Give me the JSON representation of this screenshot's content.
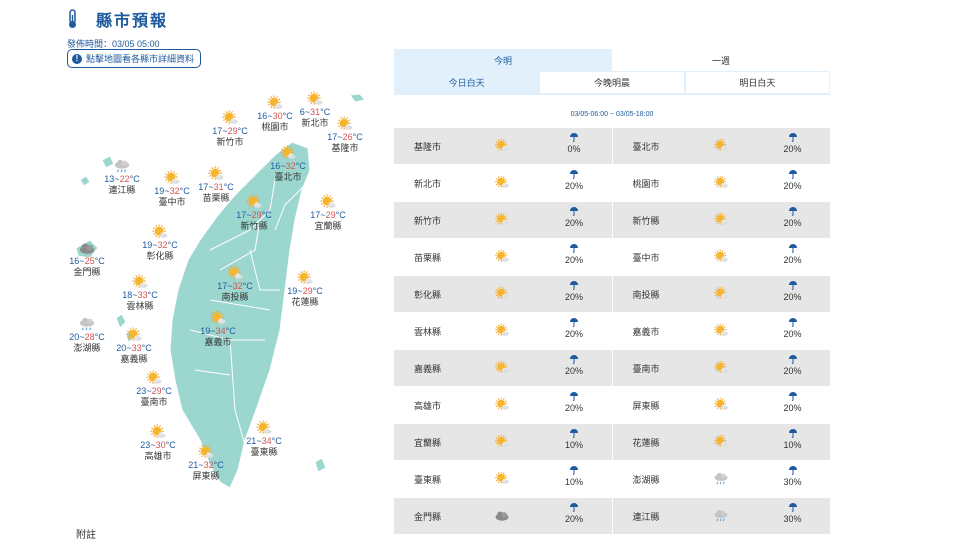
{
  "header": {
    "title": "縣市預報",
    "publish_time": "發佈時間：03/05 05:00",
    "detail_button": "點擊地圖看各縣市詳細資料"
  },
  "map_cities": [
    {
      "name": "新竹市",
      "low": "17",
      "high": "29",
      "weather": "sunny-cloudy"
    },
    {
      "name": "桃園市",
      "low": "16",
      "high": "30",
      "weather": "sunny-cloudy"
    },
    {
      "name": "新北市",
      "low": "6",
      "high": "31",
      "weather": "sunny-cloudy"
    },
    {
      "name": "基隆市",
      "low": "17",
      "high": "26",
      "weather": "sunny-cloudy"
    },
    {
      "name": "連江縣",
      "low": "13",
      "high": "22",
      "weather": "cloudy-rain"
    },
    {
      "name": "臺中市",
      "low": "19",
      "high": "32",
      "weather": "sunny-cloudy"
    },
    {
      "name": "苗栗縣",
      "low": "17",
      "high": "31",
      "weather": "sunny-cloudy"
    },
    {
      "name": "臺北市",
      "low": "16",
      "high": "32",
      "weather": "sunny-cloudy"
    },
    {
      "name": "新竹縣",
      "low": "17",
      "high": "29",
      "weather": "sunny-cloudy"
    },
    {
      "name": "宜蘭縣",
      "low": "17",
      "high": "29",
      "weather": "sunny-cloudy"
    },
    {
      "name": "彰化縣",
      "low": "19",
      "high": "32",
      "weather": "sunny-cloudy"
    },
    {
      "name": "金門縣",
      "low": "16",
      "high": "25",
      "weather": "cloudy"
    },
    {
      "name": "南投縣",
      "low": "17",
      "high": "32",
      "weather": "sunny-cloudy"
    },
    {
      "name": "花蓮縣",
      "low": "19",
      "high": "29",
      "weather": "sunny-cloudy"
    },
    {
      "name": "雲林縣",
      "low": "18",
      "high": "33",
      "weather": "sunny-cloudy"
    },
    {
      "name": "嘉義市",
      "low": "19",
      "high": "34",
      "weather": "sunny-cloudy"
    },
    {
      "name": "澎湖縣",
      "low": "20",
      "high": "28",
      "weather": "cloudy-rain"
    },
    {
      "name": "嘉義縣",
      "low": "20",
      "high": "33",
      "weather": "sunny-cloudy"
    },
    {
      "name": "臺南市",
      "low": "23",
      "high": "29",
      "weather": "sunny-cloudy"
    },
    {
      "name": "臺東縣",
      "low": "21",
      "high": "34",
      "weather": "sunny-cloudy"
    },
    {
      "name": "高雄市",
      "low": "23",
      "high": "30",
      "weather": "sunny-cloudy"
    },
    {
      "name": "屏東縣",
      "low": "21",
      "high": "32",
      "weather": "sunny-cloudy"
    }
  ],
  "temp_unit": "°C",
  "footnote": "附註",
  "panel": {
    "tabs": [
      "今明",
      "一週"
    ],
    "subtabs": [
      "今日白天",
      "今晚明晨",
      "明日白天"
    ],
    "range": "03/05-06:00 ~ 03/05-18:00"
  },
  "table_rows": [
    [
      {
        "name": "基隆市",
        "weather": "sunny-cloudy",
        "rain": "0%"
      },
      {
        "name": "臺北市",
        "weather": "sunny-cloudy",
        "rain": "20%"
      }
    ],
    [
      {
        "name": "新北市",
        "weather": "sunny-cloudy",
        "rain": "20%"
      },
      {
        "name": "桃園市",
        "weather": "sunny-cloudy",
        "rain": "20%"
      }
    ],
    [
      {
        "name": "新竹市",
        "weather": "sunny-cloudy",
        "rain": "20%"
      },
      {
        "name": "新竹縣",
        "weather": "sunny-cloudy",
        "rain": "20%"
      }
    ],
    [
      {
        "name": "苗栗縣",
        "weather": "sunny-cloudy",
        "rain": "20%"
      },
      {
        "name": "臺中市",
        "weather": "sunny-cloudy",
        "rain": "20%"
      }
    ],
    [
      {
        "name": "彰化縣",
        "weather": "sunny-cloudy",
        "rain": "20%"
      },
      {
        "name": "南投縣",
        "weather": "sunny-cloudy",
        "rain": "20%"
      }
    ],
    [
      {
        "name": "雲林縣",
        "weather": "sunny-cloudy",
        "rain": "20%"
      },
      {
        "name": "嘉義市",
        "weather": "sunny-cloudy",
        "rain": "20%"
      }
    ],
    [
      {
        "name": "嘉義縣",
        "weather": "sunny-cloudy",
        "rain": "20%"
      },
      {
        "name": "臺南市",
        "weather": "sunny-cloudy",
        "rain": "20%"
      }
    ],
    [
      {
        "name": "高雄市",
        "weather": "sunny-cloudy",
        "rain": "20%"
      },
      {
        "name": "屏東縣",
        "weather": "sunny-cloudy",
        "rain": "20%"
      }
    ],
    [
      {
        "name": "宜蘭縣",
        "weather": "sunny-cloudy",
        "rain": "10%"
      },
      {
        "name": "花蓮縣",
        "weather": "sunny-cloudy",
        "rain": "10%"
      }
    ],
    [
      {
        "name": "臺東縣",
        "weather": "sunny-cloudy",
        "rain": "10%"
      },
      {
        "name": "澎湖縣",
        "weather": "cloudy-rain",
        "rain": "30%"
      }
    ],
    [
      {
        "name": "金門縣",
        "weather": "cloudy",
        "rain": "20%"
      },
      {
        "name": "連江縣",
        "weather": "cloudy-rain",
        "rain": "30%"
      }
    ]
  ],
  "colors": {
    "accent": "#1f5a9e",
    "high_temp": "#d9534f",
    "land": "#9bd6cf",
    "tab_bg": "#e1f0fb"
  }
}
